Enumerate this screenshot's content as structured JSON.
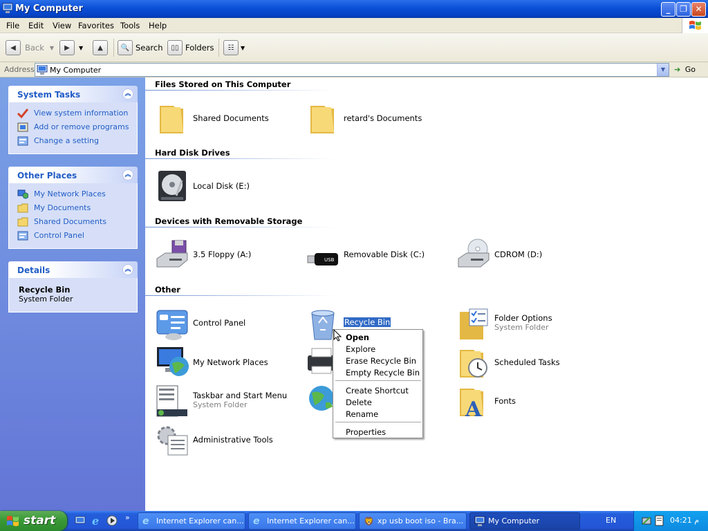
{
  "window": {
    "title": "My Computer"
  },
  "menubar": {
    "items": [
      "File",
      "Edit",
      "View",
      "Favorites",
      "Tools",
      "Help"
    ]
  },
  "toolbar": {
    "back_label": "Back",
    "search_label": "Search",
    "folders_label": "Folders"
  },
  "address": {
    "label": "Address",
    "value": "My Computer",
    "go_label": "Go"
  },
  "left_pane": {
    "system_tasks": {
      "title": "System Tasks",
      "items": [
        "View system information",
        "Add or remove programs",
        "Change a setting"
      ]
    },
    "other_places": {
      "title": "Other Places",
      "items": [
        "My Network Places",
        "My Documents",
        "Shared Documents",
        "Control Panel"
      ]
    },
    "details": {
      "title": "Details",
      "name": "Recycle Bin",
      "type": "System Folder"
    }
  },
  "groups": {
    "files_stored": {
      "title": "Files Stored on This Computer",
      "items": [
        "Shared Documents",
        "retard's Documents"
      ]
    },
    "hard_disks": {
      "title": "Hard Disk Drives",
      "items": [
        "Local Disk (E:)"
      ]
    },
    "removable": {
      "title": "Devices with Removable Storage",
      "items": [
        "3.5 Floppy (A:)",
        "Removable Disk (C:)",
        "CDROM (D:)"
      ]
    },
    "other": {
      "title": "Other",
      "items": [
        {
          "label": "Control Panel",
          "sub": ""
        },
        {
          "label": "Recycle Bin",
          "sub": ""
        },
        {
          "label": "Folder Options",
          "sub": "System Folder"
        },
        {
          "label": "My Network Places",
          "sub": ""
        },
        {
          "label": "Scheduled Tasks",
          "sub": ""
        },
        {
          "label": "Taskbar and Start Menu",
          "sub": "System Folder"
        },
        {
          "label": "Fonts",
          "sub": ""
        },
        {
          "label": "Administrative Tools",
          "sub": ""
        }
      ]
    }
  },
  "context_menu": {
    "items": [
      "Open",
      "Explore",
      "Erase Recycle Bin",
      "Empty Recycle Bin",
      "Create Shortcut",
      "Delete",
      "Rename",
      "Properties"
    ]
  },
  "taskbar": {
    "start_label": "start",
    "overflow": "»",
    "buttons": [
      "Internet Explorer can...",
      "Internet Explorer can...",
      "xp usb boot iso - Bra...",
      "My Computer"
    ],
    "language": "EN",
    "clock": "04:21 م"
  },
  "colors": {
    "titlebar": "#0a50d8",
    "taskpane": "#6e8fe0",
    "link": "#215dc6",
    "selection": "#316ac5",
    "start": "#3a9a36"
  }
}
